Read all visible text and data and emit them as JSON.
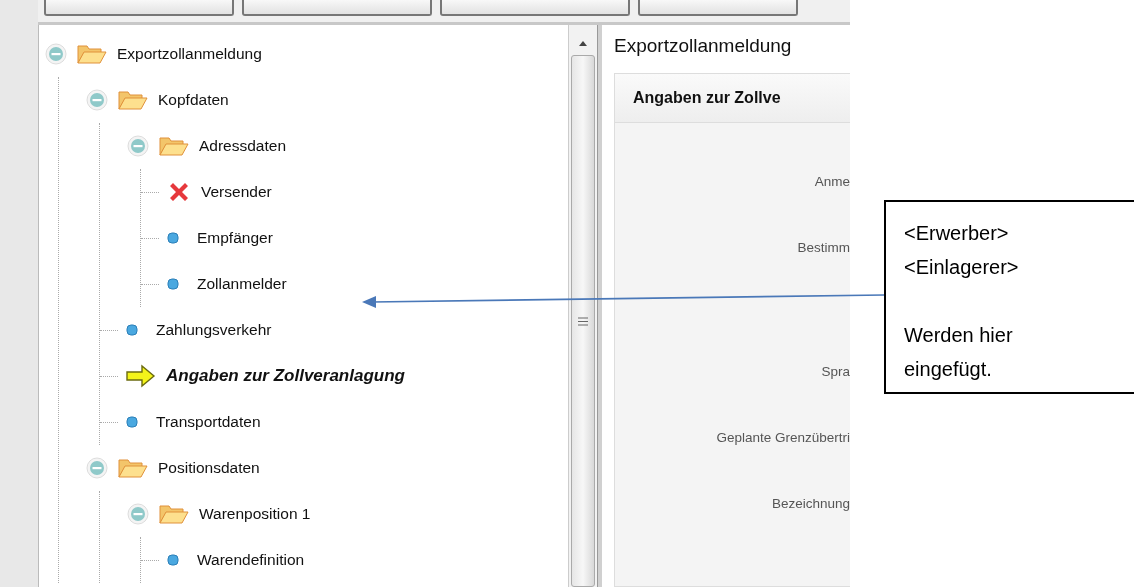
{
  "tree": [
    {
      "label": "Exportzollanmeldung",
      "kind": "folder",
      "expanded": true,
      "children": [
        {
          "label": "Kopfdaten",
          "kind": "folder",
          "expanded": true,
          "children": [
            {
              "label": "Adressdaten",
              "kind": "folder",
              "expanded": true,
              "children": [
                {
                  "label": "Versender",
                  "kind": "error"
                },
                {
                  "label": "Empfänger",
                  "kind": "dot"
                },
                {
                  "label": "Zollanmelder",
                  "kind": "dot"
                }
              ]
            },
            {
              "label": "Zahlungsverkehr",
              "kind": "dot"
            },
            {
              "label": "Angaben zur Zollveranlagung",
              "kind": "current"
            },
            {
              "label": "Transportdaten",
              "kind": "dot"
            }
          ]
        },
        {
          "label": "Positionsdaten",
          "kind": "folder",
          "expanded": true,
          "children": [
            {
              "label": "Warenposition 1",
              "kind": "folder",
              "expanded": true,
              "children": [
                {
                  "label": "Warendefinition",
                  "kind": "dot"
                }
              ]
            }
          ]
        }
      ]
    }
  ],
  "detail": {
    "title": "Exportzollanmeldung",
    "section": "Angaben zur Zollve",
    "fields": [
      "Anme",
      "Bestimm",
      "Spra",
      "Geplante Grenzübertri",
      "Bezeichnung"
    ]
  },
  "callout": {
    "lines": [
      "<Erwerber>",
      "<Einlagerer>"
    ],
    "note": "Werden hier eingefügt."
  }
}
